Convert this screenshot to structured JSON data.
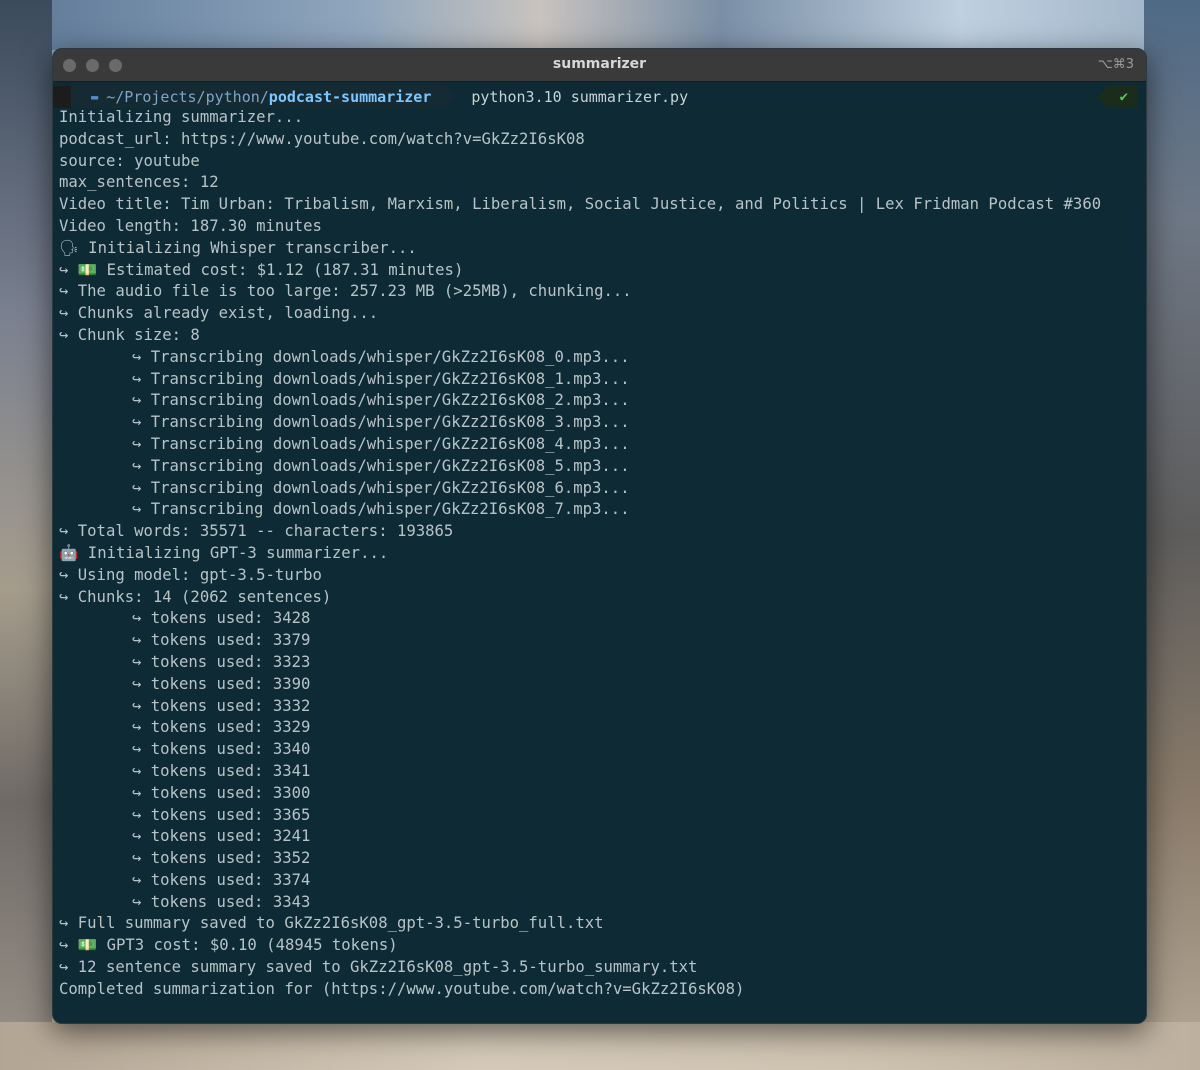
{
  "window": {
    "title": "summarizer",
    "shortcut": "⌥⌘3"
  },
  "prompt": {
    "apple_glyph": "",
    "folder_glyph": "▬",
    "path_prefix": "~/Projects/python/",
    "path_current": "podcast-summarizer",
    "command": "python3.10 summarizer.py",
    "status": "✔"
  },
  "output": [
    {
      "indent": false,
      "text": "Initializing summarizer..."
    },
    {
      "indent": false,
      "text": "podcast_url: https://www.youtube.com/watch?v=GkZz2I6sK08"
    },
    {
      "indent": false,
      "text": "source: youtube"
    },
    {
      "indent": false,
      "text": "max_sentences: 12"
    },
    {
      "indent": false,
      "text": "Video title: Tim Urban: Tribalism, Marxism, Liberalism, Social Justice, and Politics | Lex Fridman Podcast #360"
    },
    {
      "indent": false,
      "text": "Video length: 187.30 minutes"
    },
    {
      "indent": false,
      "text": "🗣 Initializing Whisper transcriber..."
    },
    {
      "indent": false,
      "text": "↪ 💵 Estimated cost: $1.12 (187.31 minutes)"
    },
    {
      "indent": false,
      "text": "↪ The audio file is too large: 257.23 MB (>25MB), chunking..."
    },
    {
      "indent": false,
      "text": "↪ Chunks already exist, loading..."
    },
    {
      "indent": false,
      "text": "↪ Chunk size: 8"
    },
    {
      "indent": true,
      "text": "↪ Transcribing downloads/whisper/GkZz2I6sK08_0.mp3..."
    },
    {
      "indent": true,
      "text": "↪ Transcribing downloads/whisper/GkZz2I6sK08_1.mp3..."
    },
    {
      "indent": true,
      "text": "↪ Transcribing downloads/whisper/GkZz2I6sK08_2.mp3..."
    },
    {
      "indent": true,
      "text": "↪ Transcribing downloads/whisper/GkZz2I6sK08_3.mp3..."
    },
    {
      "indent": true,
      "text": "↪ Transcribing downloads/whisper/GkZz2I6sK08_4.mp3..."
    },
    {
      "indent": true,
      "text": "↪ Transcribing downloads/whisper/GkZz2I6sK08_5.mp3..."
    },
    {
      "indent": true,
      "text": "↪ Transcribing downloads/whisper/GkZz2I6sK08_6.mp3..."
    },
    {
      "indent": true,
      "text": "↪ Transcribing downloads/whisper/GkZz2I6sK08_7.mp3..."
    },
    {
      "indent": false,
      "text": "↪ Total words: 35571 -- characters: 193865"
    },
    {
      "indent": false,
      "text": "🤖 Initializing GPT-3 summarizer..."
    },
    {
      "indent": false,
      "text": "↪ Using model: gpt-3.5-turbo"
    },
    {
      "indent": false,
      "text": "↪ Chunks: 14 (2062 sentences)"
    },
    {
      "indent": true,
      "text": "↪ tokens used: 3428"
    },
    {
      "indent": true,
      "text": "↪ tokens used: 3379"
    },
    {
      "indent": true,
      "text": "↪ tokens used: 3323"
    },
    {
      "indent": true,
      "text": "↪ tokens used: 3390"
    },
    {
      "indent": true,
      "text": "↪ tokens used: 3332"
    },
    {
      "indent": true,
      "text": "↪ tokens used: 3329"
    },
    {
      "indent": true,
      "text": "↪ tokens used: 3340"
    },
    {
      "indent": true,
      "text": "↪ tokens used: 3341"
    },
    {
      "indent": true,
      "text": "↪ tokens used: 3300"
    },
    {
      "indent": true,
      "text": "↪ tokens used: 3365"
    },
    {
      "indent": true,
      "text": "↪ tokens used: 3241"
    },
    {
      "indent": true,
      "text": "↪ tokens used: 3352"
    },
    {
      "indent": true,
      "text": "↪ tokens used: 3374"
    },
    {
      "indent": true,
      "text": "↪ tokens used: 3343"
    },
    {
      "indent": false,
      "text": "↪ Full summary saved to GkZz2I6sK08_gpt-3.5-turbo_full.txt"
    },
    {
      "indent": false,
      "text": "↪ 💵 GPT3 cost: $0.10 (48945 tokens)"
    },
    {
      "indent": false,
      "text": "↪ 12 sentence summary saved to GkZz2I6sK08_gpt-3.5-turbo_summary.txt"
    },
    {
      "indent": false,
      "text": "Completed summarization for (https://www.youtube.com/watch?v=GkZz2I6sK08)"
    }
  ]
}
